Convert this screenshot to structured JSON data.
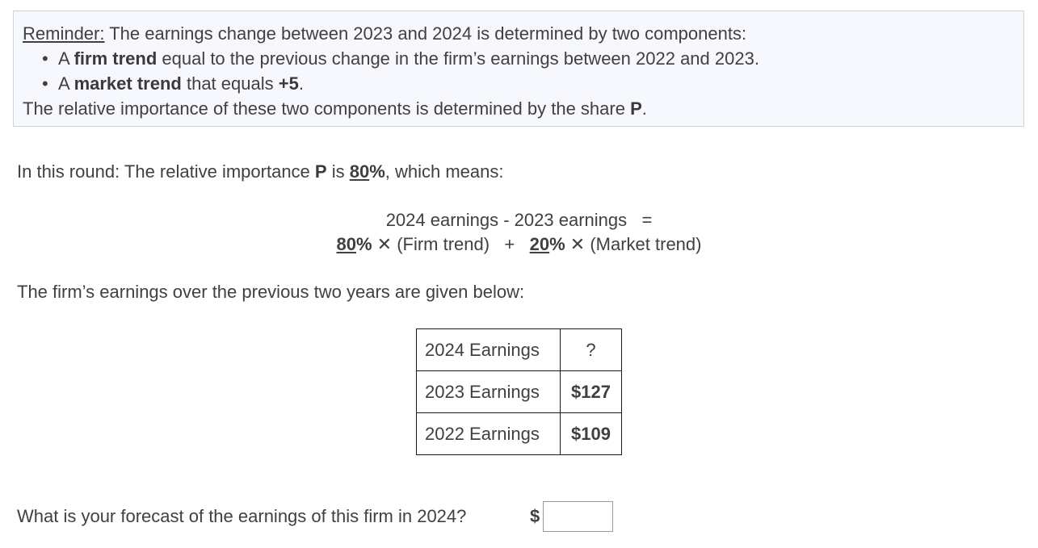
{
  "reminder": {
    "title": "Reminder:",
    "intro": " The earnings change between 2023 and 2024 is determined by two components:",
    "bullets": [
      {
        "pre": "A ",
        "bold": "firm trend",
        "post": " equal to the previous change in the firm’s earnings between 2022 and 2023."
      },
      {
        "pre": "A ",
        "bold": "market trend",
        "post": " that equals ",
        "bold2": "+5",
        "post2": "."
      }
    ],
    "closing_pre": "The relative importance of these two components is determined by the share ",
    "closing_bold": "P",
    "closing_post": "."
  },
  "round": {
    "pre": "In this round: The relative importance ",
    "p_label": "P",
    "mid": " is ",
    "p_value": "80",
    "percent": "%",
    "post": ", which means:"
  },
  "equation": {
    "line1": "2024 earnings - 2023 earnings   =",
    "firm_share": "80",
    "firm_term": " (Firm trend)   +   ",
    "market_share": "20",
    "market_term": " (Market trend)",
    "percent": "%",
    "times": " ✕"
  },
  "earnings_intro": "The firm’s earnings over the previous two years are given below:",
  "earnings_table": [
    {
      "label": "2024 Earnings",
      "value": "?"
    },
    {
      "label": "2023 Earnings",
      "value": "$127"
    },
    {
      "label": "2022 Earnings",
      "value": "$109"
    }
  ],
  "question": "What is your forecast of the earnings of this firm in 2024?",
  "currency_symbol": "$",
  "forecast_input": {
    "value": "",
    "placeholder": ""
  }
}
